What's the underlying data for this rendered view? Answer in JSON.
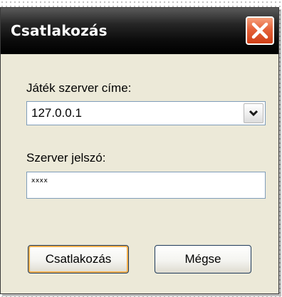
{
  "dialog": {
    "title": "Csatlakozás",
    "close_icon": "close-icon"
  },
  "server_address": {
    "label": "Játék szerver címe:",
    "value": "127.0.0.1",
    "dropdown_icon": "chevron-down-icon"
  },
  "server_password": {
    "label": "Szerver jelszó:",
    "value": "xxxx"
  },
  "buttons": {
    "connect_label": "Csatlakozás",
    "cancel_label": "Mégse"
  },
  "colors": {
    "titlebar": "#000000",
    "close_button": "#e5623a",
    "window_background": "#ece9d8",
    "default_button_highlight": "#f3b04e"
  }
}
